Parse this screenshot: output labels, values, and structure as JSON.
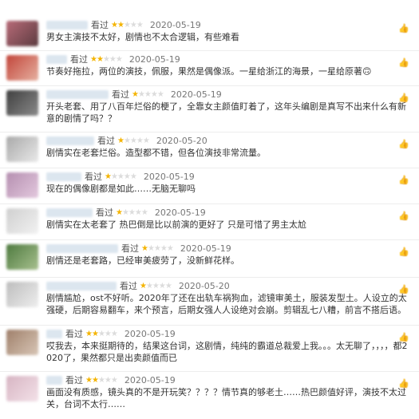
{
  "reviews": [
    {
      "badge": "看过",
      "rating": 2,
      "date": "2020-05-19",
      "text": "男女主演技不太好，剧情也不太合逻辑，有些难看"
    },
    {
      "badge": "看过",
      "rating": 2,
      "date": "2020-05-19",
      "text": "节奏好拖拉，两位的演技，佩服，果然是偶像派。一星给浙江的海景，一星给原著🙃"
    },
    {
      "badge": "看过",
      "rating": 1,
      "date": "2020-05-19",
      "text": "开头老套、用了八百年烂俗的梗了，全靠女主颜值盯着了，这年头编剧是真写不出来什么有新意的剧情了吗？？"
    },
    {
      "badge": "看过",
      "rating": 1,
      "date": "2020-05-20",
      "text": "剧情实在老套烂俗。造型都不错，但各位演技非常流量。"
    },
    {
      "badge": "看过",
      "rating": 1,
      "date": "2020-05-19",
      "text": "现在的偶像剧都是如此……无脑无聊吗"
    },
    {
      "badge": "看过",
      "rating": 1,
      "date": "2020-05-19",
      "text": "剧情实在太老套了 热巴倒是比以前演的更好了 只是可惜了男主太尬"
    },
    {
      "badge": "看过",
      "rating": 1,
      "date": "2020-05-19",
      "text": "剧情还是老套路，已经审美疲劳了，没新鲜花样。"
    },
    {
      "badge": "看过",
      "rating": 1,
      "date": "2020-05-20",
      "text": "剧情尴尬，ost不好听。2020年了还在出轨车祸狗血，滤镜审美土，服装发型土。人设立的太强硬，后期容易翻车，来个预言，后期女强人人设绝对会崩。剪辑乱七八糟，前言不搭后语。"
    },
    {
      "badge": "看过",
      "rating": 2,
      "date": "2020-05-19",
      "text": "哎我去，本来挺期待的，结果这台词，这剧情，纯纯的霸道总裁爱上我。。。太无聊了，，，，都2020了，果然都只是出卖颜值而已"
    },
    {
      "badge": "看过",
      "rating": 2,
      "date": "2020-05-19",
      "text": "画面没有质感，镜头真的不是开玩笑？？？？情节真的够老土……热巴颜值好评，演技不太过关，台词不太行……"
    }
  ],
  "colors": {
    "star_on": "#f4b400",
    "star_off": "#dcdcdc",
    "date": "#777777",
    "text": "#333333"
  }
}
